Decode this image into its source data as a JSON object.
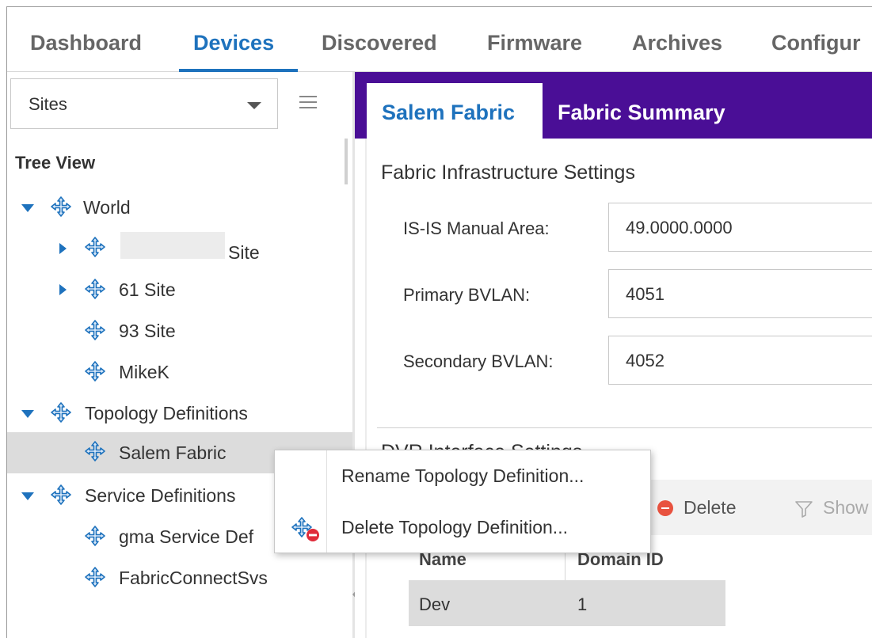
{
  "topnav": {
    "tabs": [
      "Dashboard",
      "Devices",
      "Discovered",
      "Firmware",
      "Archives",
      "Configur"
    ],
    "active_tab": "Devices"
  },
  "left": {
    "selector_value": "Sites",
    "tree_title": "Tree View",
    "tree": {
      "world": "World",
      "redacted_site_suffix": "Site",
      "site_61": "61 Site",
      "site_93": "93 Site",
      "mikek": "MikeK",
      "topology_definitions": "Topology Definitions",
      "salem_fabric": "Salem Fabric",
      "service_definitions": "Service Definitions",
      "gma_service": "gma Service Def",
      "fabric_connect": "FabricConnectSvs"
    }
  },
  "right": {
    "tabs": {
      "salem": "Salem Fabric",
      "summary": "Fabric Summary"
    },
    "infra_title": "Fabric Infrastructure Settings",
    "fields": [
      {
        "label": "IS-IS Manual Area:",
        "value": "49.0000.0000"
      },
      {
        "label": "Primary BVLAN:",
        "value": "4051"
      },
      {
        "label": "Secondary BVLAN:",
        "value": "4052"
      }
    ],
    "dvr_title": "DVR Interface Settings",
    "toolbar": {
      "delete": "Delete",
      "show": "Show"
    },
    "grid": {
      "headers": [
        "Name",
        "Domain ID"
      ],
      "rows": [
        [
          "Dev",
          "1"
        ]
      ]
    }
  },
  "context_menu": {
    "rename": "Rename Topology Definition...",
    "delete": "Delete Topology Definition..."
  },
  "colors": {
    "accent_blue": "#1e72bd",
    "tab_purple": "#4a0e96",
    "delete_red": "#e8523f"
  }
}
